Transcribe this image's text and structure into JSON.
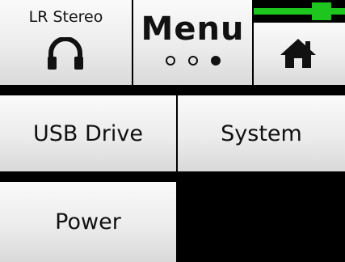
{
  "header": {
    "output_mode": "LR Stereo",
    "output_icon": "headphones-icon",
    "title": "Menu",
    "page_dots": [
      "inactive",
      "inactive",
      "active"
    ],
    "home_icon": "home-icon",
    "level_meter_color": "#1fc51f"
  },
  "menu": {
    "usb_drive": "USB Drive",
    "system": "System",
    "power": "Power"
  }
}
